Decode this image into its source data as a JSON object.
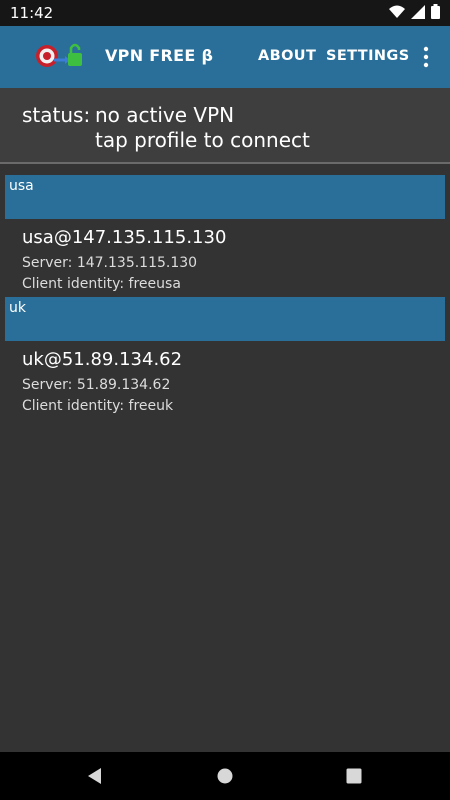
{
  "status_bar": {
    "time": "11:42",
    "icons": [
      "wifi-icon",
      "signal-icon",
      "battery-icon"
    ]
  },
  "app_bar": {
    "title": "VPN FREE β",
    "logo": "vpn-logo-icon",
    "menu": {
      "about": "ABOUT",
      "settings": "SETTINGS"
    },
    "overflow_icon": "more-vert-icon",
    "color": "#2a6f99"
  },
  "status": {
    "label": "status:",
    "line1": "no active VPN",
    "line2": "tap profile to connect"
  },
  "groups": [
    {
      "header": "usa",
      "profile": {
        "name": "usa@147.135.115.130",
        "server": "Server: 147.135.115.130",
        "identity": "Client identity: freeusa"
      }
    },
    {
      "header": "uk",
      "profile": {
        "name": "uk@51.89.134.62",
        "server": "Server: 51.89.134.62",
        "identity": "Client identity: freeuk"
      }
    }
  ],
  "nav_bar": {
    "icons": [
      "back-icon",
      "home-icon",
      "recents-icon"
    ]
  }
}
